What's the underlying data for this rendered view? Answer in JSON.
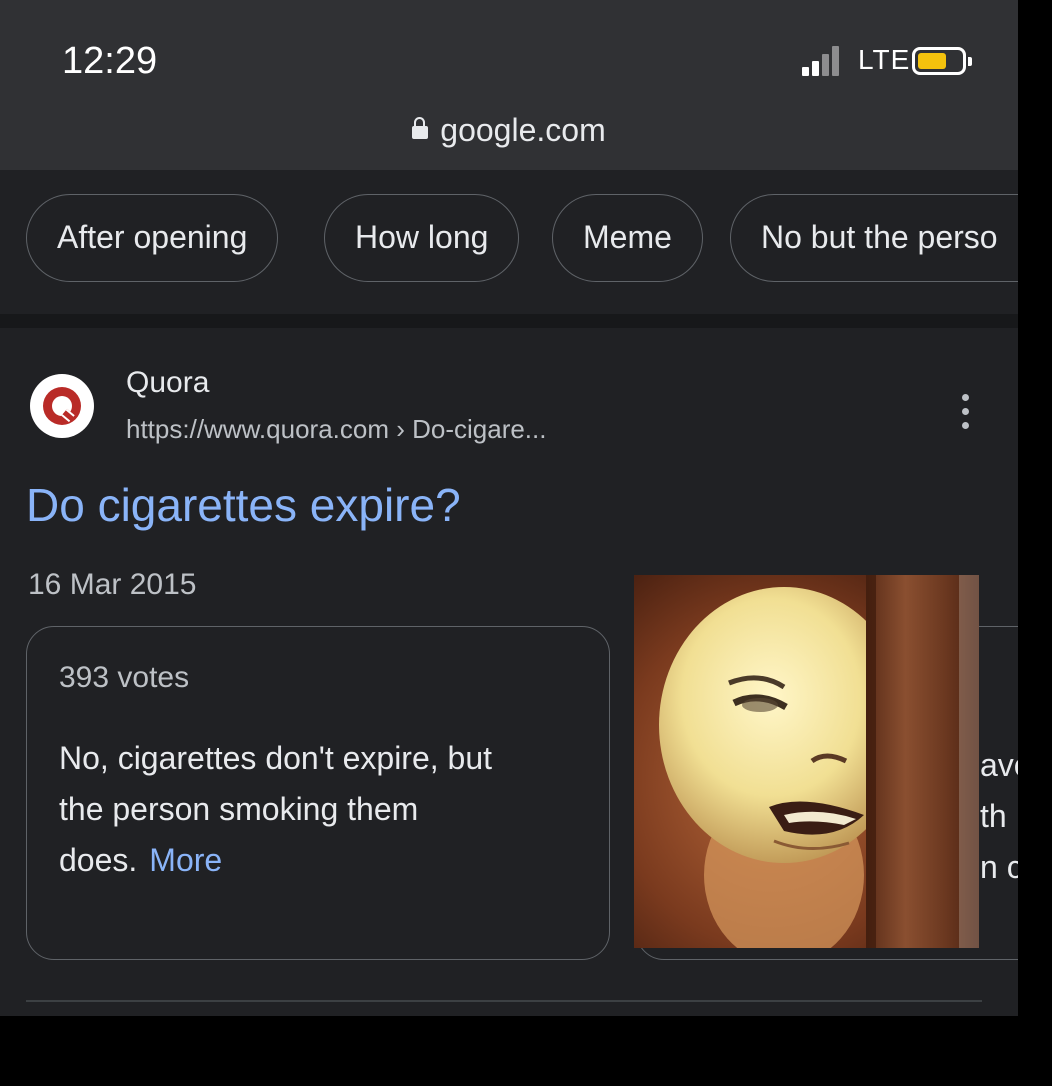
{
  "status_bar": {
    "time": "12:29",
    "network": "LTE"
  },
  "browser": {
    "url": "google.com"
  },
  "chips": [
    "After opening",
    "How long",
    "Meme",
    "No but the perso"
  ],
  "result": {
    "site_name": "Quora",
    "site_url": "https://www.quora.com › Do-cigare...",
    "title": "Do cigarettes expire?",
    "date": "16 Mar 2015"
  },
  "answer_card": {
    "votes": "393 votes",
    "lines": [
      "No, cigarettes don't expire, but",
      "the person smoking them",
      "does."
    ],
    "more_label": "More"
  },
  "second_card_fragments": [
    "ave",
    "th",
    "n c"
  ],
  "colors": {
    "link": "#8ab4f8",
    "background": "#202124",
    "status_bar": "#303134",
    "battery": "#f4c20d"
  },
  "icons": [
    "lock-icon",
    "signal-icon",
    "battery-icon",
    "quora-favicon",
    "more-vert-icon"
  ]
}
